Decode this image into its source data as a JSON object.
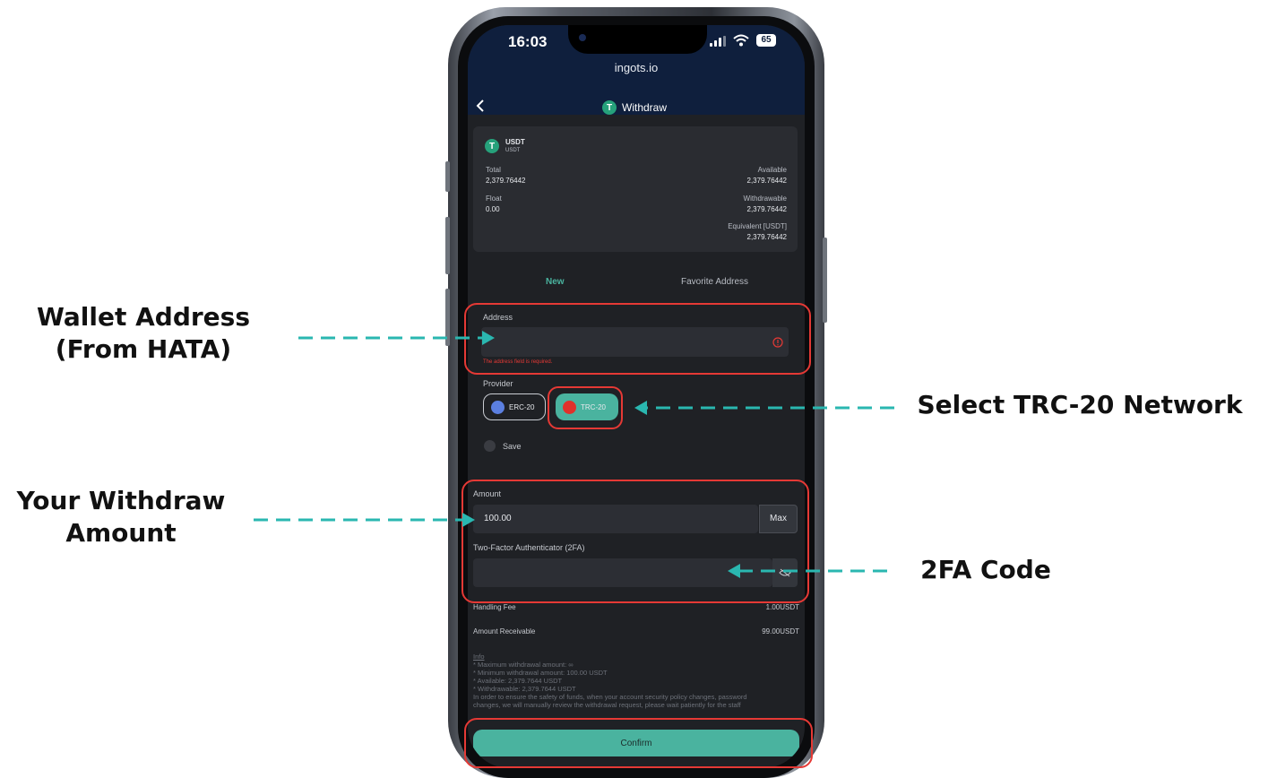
{
  "status": {
    "time": "16:03",
    "battery": "65",
    "url": "ingots.io"
  },
  "header": {
    "title": "Withdraw",
    "coin_icon": "T"
  },
  "asset": {
    "symbol": "USDT",
    "name": "USDT",
    "total_label": "Total",
    "total": "2,379.76442",
    "float_label": "Float",
    "float": "0.00",
    "available_label": "Available",
    "available": "2,379.76442",
    "withdrawable_label": "Withdrawable",
    "withdrawable": "2,379.76442",
    "equivalent_label": "Equivalent [USDT]",
    "equivalent": "2,379.76442"
  },
  "tabs": [
    {
      "label": "New",
      "active": true
    },
    {
      "label": "Favorite Address",
      "active": false
    }
  ],
  "address": {
    "label": "Address",
    "value": "",
    "error": "The address field is required."
  },
  "provider": {
    "label": "Provider",
    "options": [
      {
        "label": "ERC-20",
        "selected": false
      },
      {
        "label": "TRC-20",
        "selected": true
      }
    ]
  },
  "save_label": "Save",
  "amount": {
    "label": "Amount",
    "value": "100.00",
    "max_label": "Max"
  },
  "twofa": {
    "label": "Two-Factor Authenticator (2FA)",
    "value": ""
  },
  "fees": {
    "fee_label": "Handling Fee",
    "fee": "1.00USDT",
    "receivable_label": "Amount Receivable",
    "receivable": "99.00USDT"
  },
  "info": {
    "title": "Info",
    "lines": [
      "* Maximum withdrawal amount: ∞",
      "* Minimum withdrawal amount: 100.00 USDT",
      "* Available: 2,379.7644 USDT",
      "* Withdrawable: 2,379.7644 USDT",
      "In order to ensure the safety of funds, when your account security policy changes, password",
      "changes, we will manually review the withdrawal request, please wait patiently for the staff"
    ]
  },
  "confirm_label": "Confirm",
  "annotations": {
    "wallet": [
      "Wallet Address",
      "(From HATA)"
    ],
    "network": "Select TRC-20 Network",
    "amount": [
      "Your Withdraw",
      "Amount"
    ],
    "twofa": "2FA Code"
  },
  "colors": {
    "accent": "#4ab39f",
    "arrow": "#2ab7b0",
    "highlight": "#e53935",
    "trc": "#e0312b",
    "erc": "#5b7fe0"
  }
}
